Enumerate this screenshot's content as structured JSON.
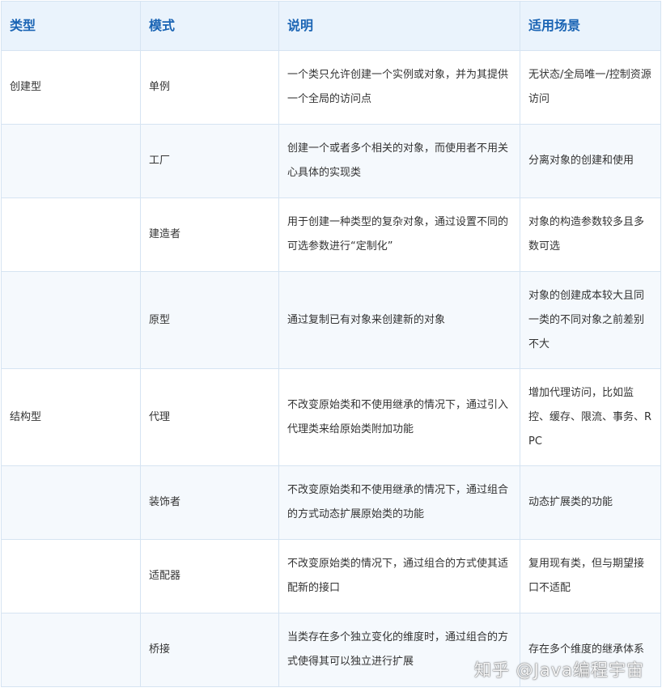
{
  "table": {
    "headers": [
      "类型",
      "模式",
      "说明",
      "适用场景"
    ],
    "rows": [
      {
        "category": "创建型",
        "pattern": "单例",
        "description": "一个类只允许创建一个实例或对象，并为其提供一个全局的访问点",
        "scenario": "无状态/全局唯一/控制资源访问"
      },
      {
        "category": "",
        "pattern": "工厂",
        "description": "创建一个或者多个相关的对象，而使用者不用关心具体的实现类",
        "scenario": "分离对象的创建和使用"
      },
      {
        "category": "",
        "pattern": "建造者",
        "description": "用于创建一种类型的复杂对象，通过设置不同的可选参数进行“定制化”",
        "scenario": "对象的构造参数较多且多数可选"
      },
      {
        "category": "",
        "pattern": "原型",
        "description": "通过复制已有对象来创建新的对象",
        "scenario": "对象的创建成本较大且同一类的不同对象之前差别不大"
      },
      {
        "category": "结构型",
        "pattern": "代理",
        "description": "不改变原始类和不使用继承的情况下，通过引入代理类来给原始类附加功能",
        "scenario": "增加代理访问，比如监控、缓存、限流、事务、RPC"
      },
      {
        "category": "",
        "pattern": "装饰者",
        "description": "不改变原始类和不使用继承的情况下，通过组合的方式动态扩展原始类的功能",
        "scenario": "动态扩展类的功能"
      },
      {
        "category": "",
        "pattern": "适配器",
        "description": "不改变原始类的情况下，通过组合的方式使其适配新的接口",
        "scenario": "复用现有类，但与期望接口不适配"
      },
      {
        "category": "",
        "pattern": "桥接",
        "description": "当类存在多个独立变化的维度时，通过组合的方式使得其可以独立进行扩展",
        "scenario": "存在多个维度的继承体系"
      }
    ]
  },
  "watermark": {
    "text": "知乎 @Java编程宇宙"
  },
  "colors": {
    "header_bg": "#eaf3fc",
    "header_text": "#1a64b4",
    "border": "#d6e4f2",
    "stripe": "#f5f9fd"
  }
}
